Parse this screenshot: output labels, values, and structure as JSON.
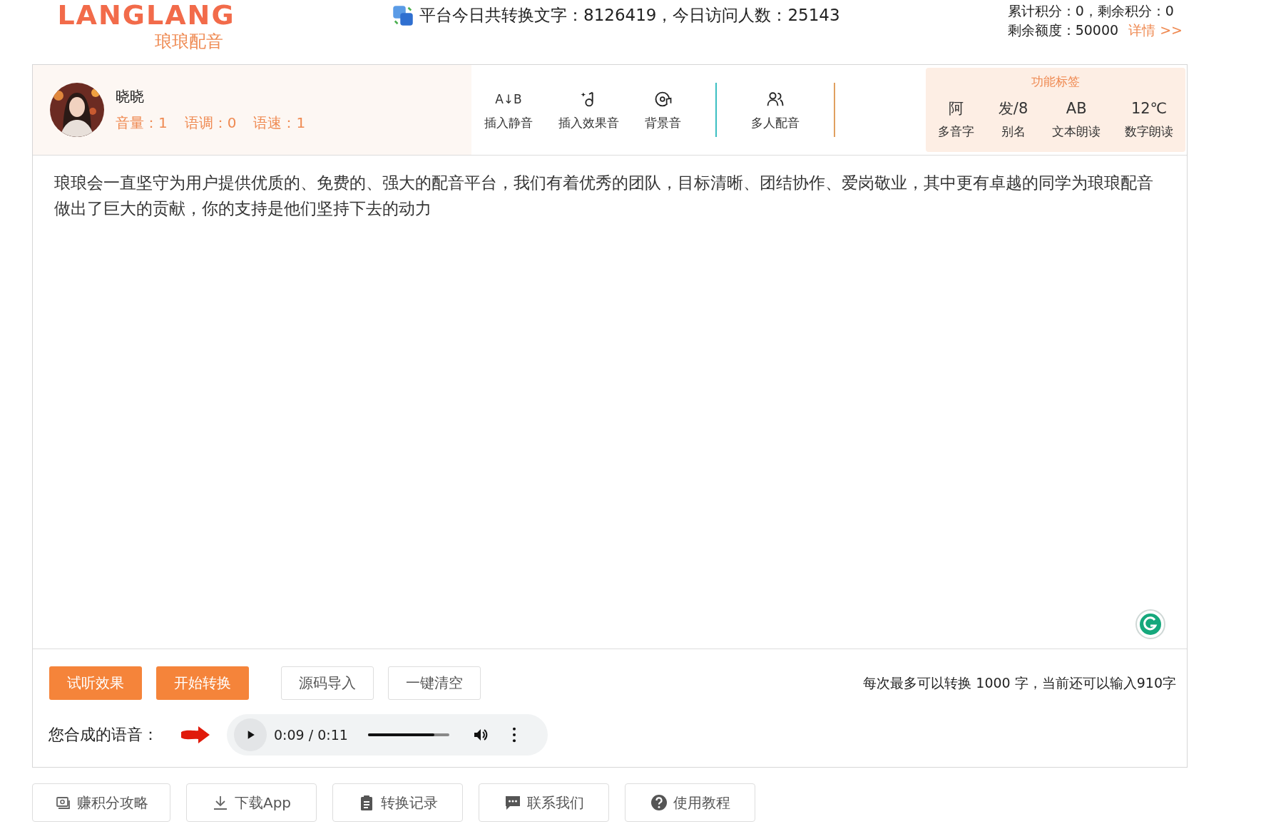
{
  "header": {
    "logo": {
      "text": "LANGLANG",
      "subtitle": "琅琅配音"
    },
    "stats": "平台今日共转换文字：8126419，今日访问人数：25143",
    "account": {
      "points": "累计积分：0，剩余积分：0",
      "quota": "剩余额度：50000",
      "details_link": "详情 >>"
    }
  },
  "voice": {
    "avatar": {
      "kind": "picture"
    },
    "name": "晓晓",
    "params": [
      "音量：1",
      "语调：0",
      "语速：1"
    ]
  },
  "tools": [
    {
      "kind": "silence",
      "glyph": "A↓B",
      "label": "插入静音"
    },
    {
      "kind": "effect",
      "label": "插入效果音"
    },
    {
      "kind": "music",
      "label": "背景音"
    },
    {
      "kind": "people",
      "label": "多人配音"
    }
  ],
  "function_tags": {
    "title": "功能标签",
    "items": [
      {
        "glyph": "阿",
        "label": "多音字"
      },
      {
        "glyph": "发/8",
        "label": "别名"
      },
      {
        "glyph": "AB",
        "label": "文本朗读"
      },
      {
        "glyph": "12℃",
        "label": "数字朗读"
      }
    ]
  },
  "editor": {
    "value": "琅琅会一直坚守为用户提供优质的、免费的、强大的配音平台，我们有着优秀的团队，目标清晰、团结协作、爱岗敬业，其中更有卓越的同学为琅琅配音做出了巨大的贡献，你的支持是他们坚持下去的动力"
  },
  "actions": [
    {
      "label": "试听效果",
      "kind": "primary"
    },
    {
      "label": "开始转换",
      "kind": "primary"
    },
    {
      "label": "源码导入",
      "kind": "outline"
    },
    {
      "label": "一键清空",
      "kind": "outline"
    }
  ],
  "limit_note": "每次最多可以转换 1000 字，当前还可以输入910字",
  "output": {
    "label": "您合成的语音：",
    "player": {
      "time": "0:09 / 0:11",
      "level": 0.82
    }
  },
  "footer_links": [
    {
      "kind": "earn",
      "label": "赚积分攻略"
    },
    {
      "kind": "download",
      "label": "下载App"
    },
    {
      "kind": "history",
      "label": "转换记录"
    },
    {
      "kind": "contact",
      "label": "联系我们"
    },
    {
      "kind": "help",
      "label": "使用教程"
    }
  ]
}
